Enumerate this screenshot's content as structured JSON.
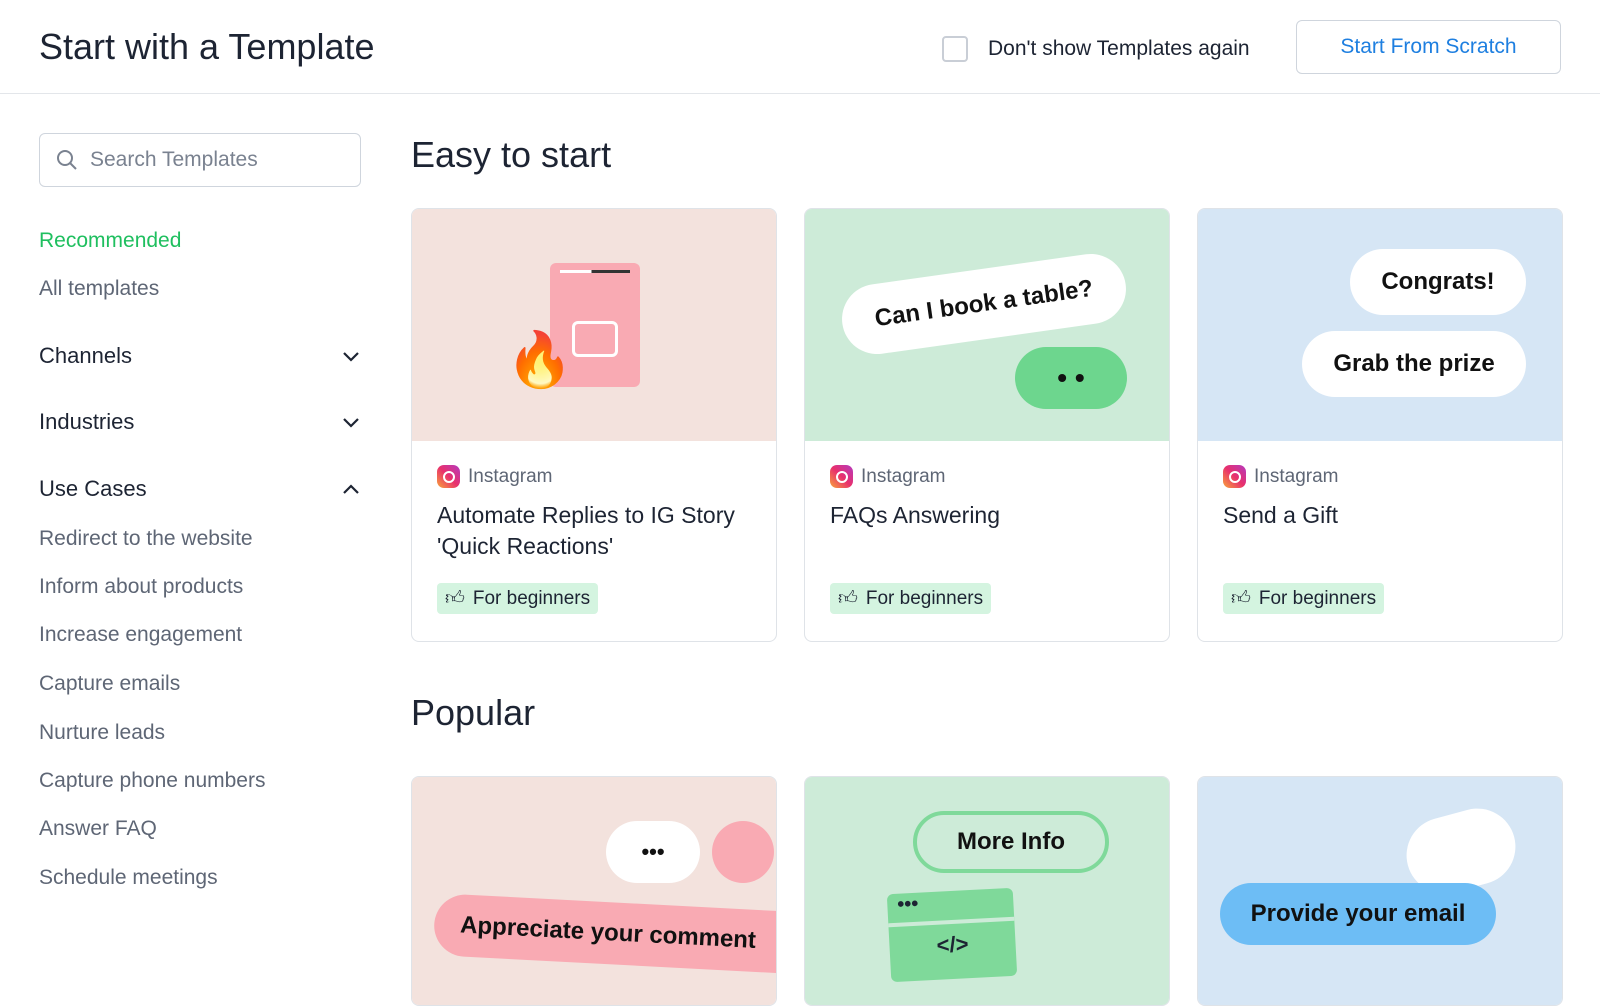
{
  "header": {
    "title": "Start with a Template",
    "dont_show_label": "Don't show Templates again",
    "dont_show_checked": false,
    "start_scratch": "Start From Scratch"
  },
  "sidebar": {
    "search_placeholder": "Search Templates",
    "recommended": "Recommended",
    "all_templates": "All templates",
    "channels": "Channels",
    "industries": "Industries",
    "use_cases": "Use Cases",
    "use_case_items": [
      "Redirect to the website",
      "Inform about products",
      "Increase engagement",
      "Capture emails",
      "Nurture leads",
      "Capture phone numbers",
      "Answer FAQ",
      "Schedule meetings"
    ]
  },
  "sections": {
    "easy": "Easy to start",
    "popular": "Popular"
  },
  "easy_cards": [
    {
      "channel": "Instagram",
      "title": "Automate Replies to IG Story 'Quick Reactions'",
      "badge": "For beginners",
      "bg": "#f3e2dd"
    },
    {
      "channel": "Instagram",
      "title": "FAQs Answering",
      "badge": "For beginners",
      "bg": "#cdebd8",
      "bubble": "Can I book a table?"
    },
    {
      "channel": "Instagram",
      "title": "Send a Gift",
      "badge": "For beginners",
      "bg": "#d6e6f5",
      "bubble1": "Congrats!",
      "bubble2": "Grab the prize"
    }
  ],
  "popular_cards": [
    {
      "bubble": "Appreciate your comment",
      "bg": "#f3e2dd"
    },
    {
      "bubble": "More Info",
      "code": "</>",
      "bg": "#cdebd8"
    },
    {
      "bubble": "Provide your email",
      "bg": "#d6e6f5"
    }
  ],
  "colors": {
    "accent_green": "#1fbf5f",
    "link_blue": "#1e7fe0",
    "badge_bg": "#d4f4e0"
  }
}
